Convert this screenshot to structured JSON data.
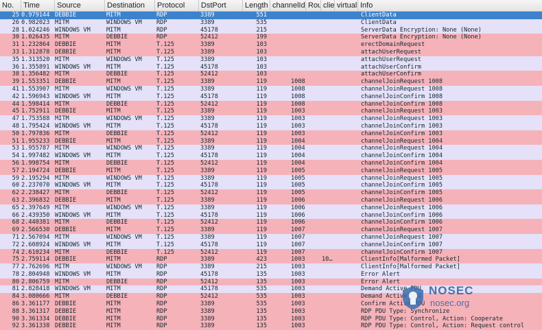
{
  "columns": [
    "No.",
    "Time",
    "Source",
    "Destination",
    "Protocol",
    "DstPort",
    "Length",
    "channelId",
    "Rou",
    "clie",
    "virtual(",
    "Info"
  ],
  "rows": [
    {
      "no": "25",
      "time": "0.979144",
      "src": "DEBBIE",
      "dst": "MITM",
      "proto": "RDP",
      "port": "3389",
      "len": "551",
      "chan": "",
      "rou": "",
      "info": "ClientData",
      "color": "sel"
    },
    {
      "no": "26",
      "time": "0.982023",
      "src": "MITM",
      "dst": "WINDOWS VM",
      "proto": "RDP",
      "port": "3389",
      "len": "535",
      "chan": "",
      "rou": "",
      "info": "ClientData",
      "color": "lav"
    },
    {
      "no": "28",
      "time": "1.024246",
      "src": "WINDOWS VM",
      "dst": "MITM",
      "proto": "RDP",
      "port": "45178",
      "len": "215",
      "chan": "",
      "rou": "",
      "info": "ServerData Encryption: None (None)",
      "color": "lav"
    },
    {
      "no": "30",
      "time": "1.026435",
      "src": "MITM",
      "dst": "DEBBIE",
      "proto": "RDP",
      "port": "52412",
      "len": "199",
      "chan": "",
      "rou": "",
      "info": "ServerData Encryption: None (None)",
      "color": "pink"
    },
    {
      "no": "31",
      "time": "1.232864",
      "src": "DEBBIE",
      "dst": "MITM",
      "proto": "T.125",
      "port": "3389",
      "len": "103",
      "chan": "",
      "rou": "",
      "info": "erectDomainRequest",
      "color": "pink"
    },
    {
      "no": "33",
      "time": "1.312878",
      "src": "DEBBIE",
      "dst": "MITM",
      "proto": "T.125",
      "port": "3389",
      "len": "103",
      "chan": "",
      "rou": "",
      "info": "attachUserRequest",
      "color": "pink"
    },
    {
      "no": "35",
      "time": "1.313520",
      "src": "MITM",
      "dst": "WINDOWS VM",
      "proto": "T.125",
      "port": "3389",
      "len": "103",
      "chan": "",
      "rou": "",
      "info": "attachUserRequest",
      "color": "lav"
    },
    {
      "no": "36",
      "time": "1.355891",
      "src": "WINDOWS VM",
      "dst": "MITM",
      "proto": "T.125",
      "port": "45178",
      "len": "103",
      "chan": "",
      "rou": "",
      "info": "attachUserConfirm",
      "color": "lav"
    },
    {
      "no": "38",
      "time": "1.356482",
      "src": "MITM",
      "dst": "DEBBIE",
      "proto": "T.125",
      "port": "52412",
      "len": "103",
      "chan": "",
      "rou": "",
      "info": "attachUserConfirm",
      "color": "pink"
    },
    {
      "no": "39",
      "time": "1.553351",
      "src": "DEBBIE",
      "dst": "MITM",
      "proto": "T.125",
      "port": "3389",
      "len": "119",
      "chan": "1008",
      "rou": "",
      "info": "channelJoinRequest 1008",
      "color": "pink"
    },
    {
      "no": "41",
      "time": "1.553907",
      "src": "MITM",
      "dst": "WINDOWS VM",
      "proto": "T.125",
      "port": "3389",
      "len": "119",
      "chan": "1008",
      "rou": "",
      "info": "channelJoinRequest 1008",
      "color": "lav"
    },
    {
      "no": "42",
      "time": "1.596943",
      "src": "WINDOWS VM",
      "dst": "MITM",
      "proto": "T.125",
      "port": "45178",
      "len": "119",
      "chan": "1008",
      "rou": "",
      "info": "channelJoinConfirm 1008",
      "color": "lav"
    },
    {
      "no": "44",
      "time": "1.598414",
      "src": "MITM",
      "dst": "DEBBIE",
      "proto": "T.125",
      "port": "52412",
      "len": "119",
      "chan": "1008",
      "rou": "",
      "info": "channelJoinConfirm 1008",
      "color": "pink"
    },
    {
      "no": "45",
      "time": "1.752911",
      "src": "DEBBIE",
      "dst": "MITM",
      "proto": "T.125",
      "port": "3389",
      "len": "119",
      "chan": "1003",
      "rou": "",
      "info": "channelJoinRequest 1003",
      "color": "pink"
    },
    {
      "no": "47",
      "time": "1.753588",
      "src": "MITM",
      "dst": "WINDOWS VM",
      "proto": "T.125",
      "port": "3389",
      "len": "119",
      "chan": "1003",
      "rou": "",
      "info": "channelJoinRequest 1003",
      "color": "lav"
    },
    {
      "no": "48",
      "time": "1.795424",
      "src": "WINDOWS VM",
      "dst": "MITM",
      "proto": "T.125",
      "port": "45178",
      "len": "119",
      "chan": "1003",
      "rou": "",
      "info": "channelJoinConfirm 1003",
      "color": "lav"
    },
    {
      "no": "50",
      "time": "1.797836",
      "src": "MITM",
      "dst": "DEBBIE",
      "proto": "T.125",
      "port": "52412",
      "len": "119",
      "chan": "1003",
      "rou": "",
      "info": "channelJoinConfirm 1003",
      "color": "pink"
    },
    {
      "no": "51",
      "time": "1.955233",
      "src": "DEBBIE",
      "dst": "MITM",
      "proto": "T.125",
      "port": "3389",
      "len": "119",
      "chan": "1004",
      "rou": "",
      "info": "channelJoinRequest 1004",
      "color": "pink"
    },
    {
      "no": "53",
      "time": "1.955787",
      "src": "MITM",
      "dst": "WINDOWS VM",
      "proto": "T.125",
      "port": "3389",
      "len": "119",
      "chan": "1004",
      "rou": "",
      "info": "channelJoinRequest 1004",
      "color": "lav"
    },
    {
      "no": "54",
      "time": "1.997482",
      "src": "WINDOWS VM",
      "dst": "MITM",
      "proto": "T.125",
      "port": "45178",
      "len": "119",
      "chan": "1004",
      "rou": "",
      "info": "channelJoinConfirm 1004",
      "color": "lav"
    },
    {
      "no": "56",
      "time": "1.998754",
      "src": "MITM",
      "dst": "DEBBIE",
      "proto": "T.125",
      "port": "52412",
      "len": "119",
      "chan": "1004",
      "rou": "",
      "info": "channelJoinConfirm 1004",
      "color": "pink"
    },
    {
      "no": "57",
      "time": "2.194724",
      "src": "DEBBIE",
      "dst": "MITM",
      "proto": "T.125",
      "port": "3389",
      "len": "119",
      "chan": "1005",
      "rou": "",
      "info": "channelJoinRequest 1005",
      "color": "pink"
    },
    {
      "no": "59",
      "time": "2.195294",
      "src": "MITM",
      "dst": "WINDOWS VM",
      "proto": "T.125",
      "port": "3389",
      "len": "119",
      "chan": "1005",
      "rou": "",
      "info": "channelJoinRequest 1005",
      "color": "lav"
    },
    {
      "no": "60",
      "time": "2.237070",
      "src": "WINDOWS VM",
      "dst": "MITM",
      "proto": "T.125",
      "port": "45178",
      "len": "119",
      "chan": "1005",
      "rou": "",
      "info": "channelJoinConfirm 1005",
      "color": "lav"
    },
    {
      "no": "62",
      "time": "2.238427",
      "src": "MITM",
      "dst": "DEBBIE",
      "proto": "T.125",
      "port": "52412",
      "len": "119",
      "chan": "1005",
      "rou": "",
      "info": "channelJoinConfirm 1005",
      "color": "pink"
    },
    {
      "no": "63",
      "time": "2.396832",
      "src": "DEBBIE",
      "dst": "MITM",
      "proto": "T.125",
      "port": "3389",
      "len": "119",
      "chan": "1006",
      "rou": "",
      "info": "channelJoinRequest 1006",
      "color": "pink"
    },
    {
      "no": "65",
      "time": "2.397649",
      "src": "MITM",
      "dst": "WINDOWS VM",
      "proto": "T.125",
      "port": "3389",
      "len": "119",
      "chan": "1006",
      "rou": "",
      "info": "channelJoinRequest 1006",
      "color": "lav"
    },
    {
      "no": "66",
      "time": "2.439350",
      "src": "WINDOWS VM",
      "dst": "MITM",
      "proto": "T.125",
      "port": "45178",
      "len": "119",
      "chan": "1006",
      "rou": "",
      "info": "channelJoinConfirm 1006",
      "color": "lav"
    },
    {
      "no": "68",
      "time": "2.440381",
      "src": "MITM",
      "dst": "DEBBIE",
      "proto": "T.125",
      "port": "52412",
      "len": "119",
      "chan": "1006",
      "rou": "",
      "info": "channelJoinConfirm 1006",
      "color": "pink"
    },
    {
      "no": "69",
      "time": "2.566530",
      "src": "DEBBIE",
      "dst": "MITM",
      "proto": "T.125",
      "port": "3389",
      "len": "119",
      "chan": "1007",
      "rou": "",
      "info": "channelJoinRequest 1007",
      "color": "pink"
    },
    {
      "no": "71",
      "time": "2.567094",
      "src": "MITM",
      "dst": "WINDOWS VM",
      "proto": "T.125",
      "port": "3389",
      "len": "119",
      "chan": "1007",
      "rou": "",
      "info": "channelJoinRequest 1007",
      "color": "lav"
    },
    {
      "no": "72",
      "time": "2.608924",
      "src": "WINDOWS VM",
      "dst": "MITM",
      "proto": "T.125",
      "port": "45178",
      "len": "119",
      "chan": "1007",
      "rou": "",
      "info": "channelJoinConfirm 1007",
      "color": "lav"
    },
    {
      "no": "74",
      "time": "2.610234",
      "src": "MITM",
      "dst": "DEBBIE",
      "proto": "T.125",
      "port": "52412",
      "len": "119",
      "chan": "1007",
      "rou": "",
      "info": "channelJoinConfirm 1007",
      "color": "pink"
    },
    {
      "no": "75",
      "time": "2.759114",
      "src": "DEBBIE",
      "dst": "MITM",
      "proto": "RDP",
      "port": "3389",
      "len": "423",
      "chan": "1003",
      "rou": "10…",
      "info": "ClientInfo[Malformed Packet]",
      "color": "pink"
    },
    {
      "no": "77",
      "time": "2.762696",
      "src": "MITM",
      "dst": "WINDOWS VM",
      "proto": "RDP",
      "port": "3389",
      "len": "215",
      "chan": "1003",
      "rou": "",
      "info": "ClientInfo[Malformed Packet]",
      "color": "lav"
    },
    {
      "no": "78",
      "time": "2.804948",
      "src": "WINDOWS VM",
      "dst": "MITM",
      "proto": "RDP",
      "port": "45178",
      "len": "135",
      "chan": "1003",
      "rou": "",
      "info": "Error Alert",
      "color": "lav"
    },
    {
      "no": "80",
      "time": "2.806759",
      "src": "MITM",
      "dst": "DEBBIE",
      "proto": "RDP",
      "port": "52412",
      "len": "135",
      "chan": "1003",
      "rou": "",
      "info": "Error Alert",
      "color": "pink"
    },
    {
      "no": "81",
      "time": "2.828418",
      "src": "WINDOWS VM",
      "dst": "MITM",
      "proto": "RDP",
      "port": "45178",
      "len": "535",
      "chan": "1003",
      "rou": "",
      "info": "Demand Active PDU",
      "color": "lav"
    },
    {
      "no": "84",
      "time": "3.080666",
      "src": "MITM",
      "dst": "DEBBIE",
      "proto": "RDP",
      "port": "52412",
      "len": "535",
      "chan": "1003",
      "rou": "",
      "info": "Demand Active PDU",
      "color": "pink"
    },
    {
      "no": "86",
      "time": "3.361177",
      "src": "DEBBIE",
      "dst": "MITM",
      "proto": "RDP",
      "port": "3389",
      "len": "535",
      "chan": "1003",
      "rou": "",
      "info": "Confirm Active PDU",
      "color": "pink"
    },
    {
      "no": "88",
      "time": "3.361317",
      "src": "DEBBIE",
      "dst": "MITM",
      "proto": "RDP",
      "port": "3389",
      "len": "135",
      "chan": "1003",
      "rou": "",
      "info": "RDP PDU Type: Synchronize",
      "color": "pink"
    },
    {
      "no": "90",
      "time": "3.361334",
      "src": "DEBBIE",
      "dst": "MITM",
      "proto": "RDP",
      "port": "3389",
      "len": "135",
      "chan": "1003",
      "rou": "",
      "info": "RDP PDU Type: Control, Action: Cooperate",
      "color": "pink"
    },
    {
      "no": "92",
      "time": "3.361338",
      "src": "DEBBIE",
      "dst": "MITM",
      "proto": "RDP",
      "port": "3389",
      "len": "135",
      "chan": "1003",
      "rou": "",
      "info": "RDP PDU Type: Control, Action: Request control",
      "color": "pink"
    }
  ],
  "watermark": {
    "title": "NOSEC",
    "subtitle": "nosec.org"
  },
  "colors": {
    "pink": "#f6b2b9",
    "lavender": "#e4e1f8",
    "selected": "#3c82cc",
    "text": "#12272e"
  }
}
